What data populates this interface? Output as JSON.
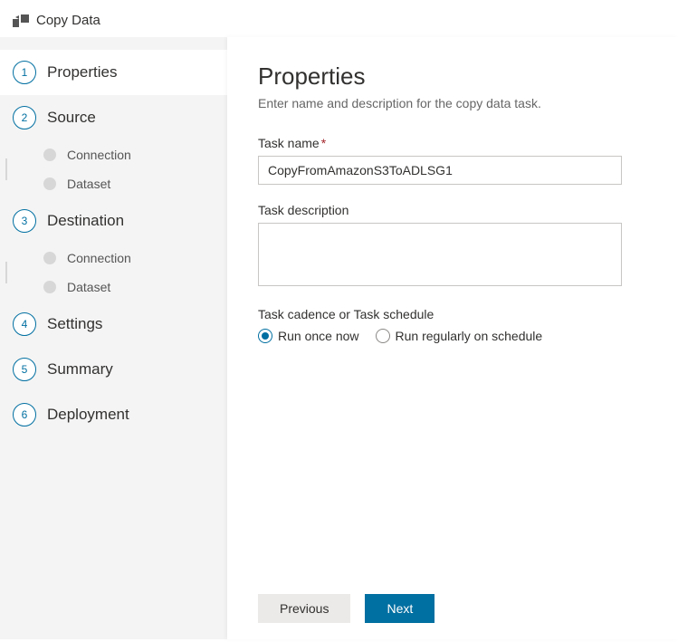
{
  "header": {
    "title": "Copy Data"
  },
  "sidebar": {
    "steps": [
      {
        "num": "1",
        "label": "Properties"
      },
      {
        "num": "2",
        "label": "Source",
        "subs": [
          "Connection",
          "Dataset"
        ]
      },
      {
        "num": "3",
        "label": "Destination",
        "subs": [
          "Connection",
          "Dataset"
        ]
      },
      {
        "num": "4",
        "label": "Settings"
      },
      {
        "num": "5",
        "label": "Summary"
      },
      {
        "num": "6",
        "label": "Deployment"
      }
    ]
  },
  "content": {
    "heading": "Properties",
    "subtitle": "Enter name and description for the copy data task.",
    "taskNameLabel": "Task name",
    "taskNameValue": "CopyFromAmazonS3ToADLSG1",
    "taskDescLabel": "Task description",
    "taskDescValue": "",
    "cadenceLabel": "Task cadence or Task schedule",
    "radio": {
      "once": "Run once now",
      "regular": "Run regularly on schedule"
    }
  },
  "footer": {
    "previous": "Previous",
    "next": "Next"
  }
}
